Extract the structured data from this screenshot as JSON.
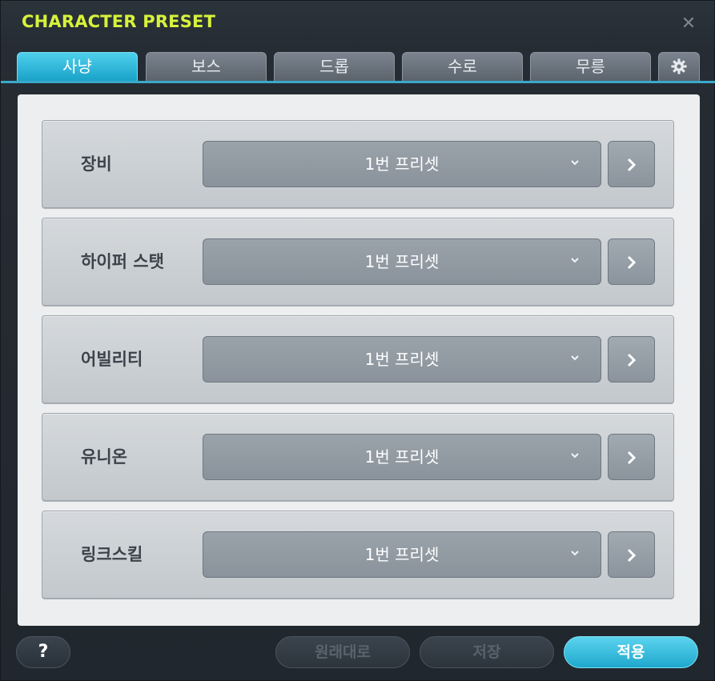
{
  "window": {
    "title": "CHARACTER PRESET",
    "close_icon": "close-icon"
  },
  "tabs": [
    {
      "label": "사냥",
      "active": true
    },
    {
      "label": "보스",
      "active": false
    },
    {
      "label": "드롭",
      "active": false
    },
    {
      "label": "수로",
      "active": false
    },
    {
      "label": "무릉",
      "active": false
    }
  ],
  "settings_tab_icon": "gear-icon",
  "rows": [
    {
      "label": "장비",
      "value": "1번 프리셋"
    },
    {
      "label": "하이퍼 스탯",
      "value": "1번 프리셋"
    },
    {
      "label": "어빌리티",
      "value": "1번 프리셋"
    },
    {
      "label": "유니온",
      "value": "1번 프리셋"
    },
    {
      "label": "링크스킬",
      "value": "1번 프리셋"
    }
  ],
  "footer": {
    "help_label": "?",
    "reset_label": "원래대로",
    "save_label": "저장",
    "apply_label": "적용"
  },
  "colors": {
    "accent": "#1aa2c8",
    "title": "#d7f23a"
  }
}
